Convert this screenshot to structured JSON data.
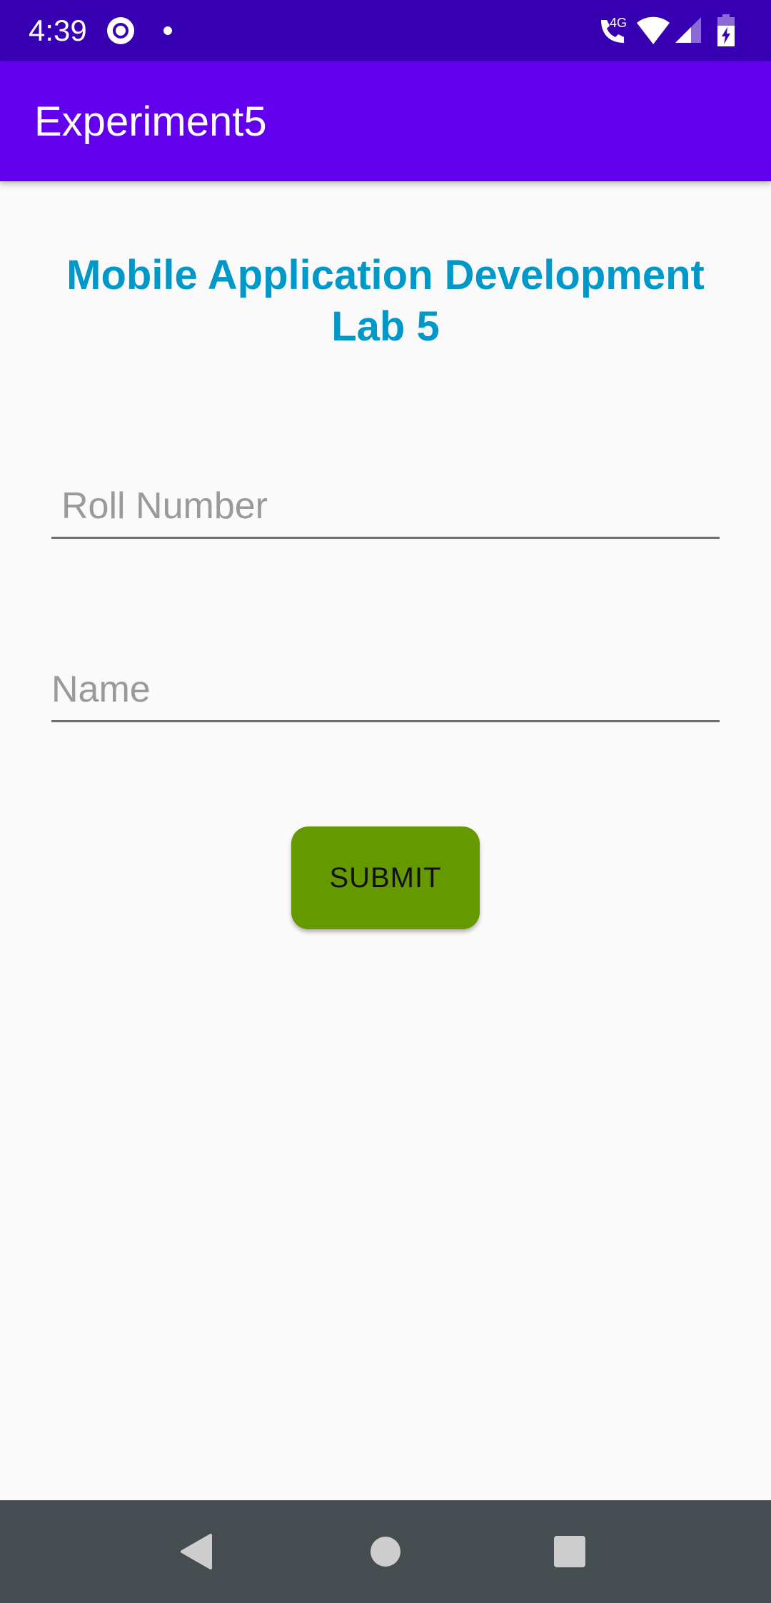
{
  "status_bar": {
    "time": "4:39",
    "network_label": "4G",
    "icons": [
      "media-ring-icon",
      "notification-dot-icon",
      "wifi-calling-icon",
      "wifi-icon",
      "cell-signal-icon",
      "battery-charging-icon"
    ]
  },
  "app_bar": {
    "title": "Experiment5"
  },
  "main": {
    "heading_line1": "Mobile Application Development",
    "heading_line2": "Lab 5",
    "roll_placeholder": "Roll Number",
    "name_placeholder": "Name",
    "submit_label": "SUBMIT"
  },
  "nav_bar": {
    "icons": [
      "back-icon",
      "home-icon",
      "recents-icon"
    ]
  },
  "colors": {
    "status_bar": "#3700b3",
    "app_bar": "#6200ee",
    "heading": "#0098c8",
    "submit": "#669900",
    "nav_bar": "#464d51"
  }
}
